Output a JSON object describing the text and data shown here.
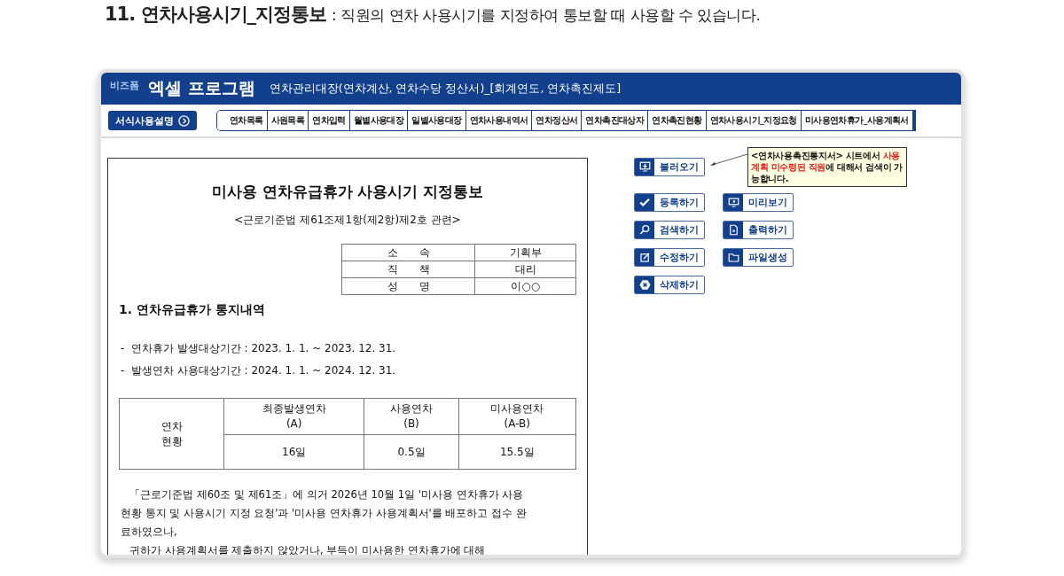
{
  "heading": {
    "title": "11. 연차사용시기_지정통보",
    "description": ": 직원의 연차 사용시기를 지정하여 통보할 때 사용할 수 있습니다."
  },
  "app_header": {
    "brand_small": "비즈폼",
    "brand": "엑셀 프로그램",
    "title": "연차관리대장(연차계산, 연차수당 정산서)_[회계연도, 연차촉진제도]"
  },
  "guide_button": {
    "label": "서식사용설명"
  },
  "tabs": [
    {
      "label": "연차목록"
    },
    {
      "label": "사원목록"
    },
    {
      "label": "연차입력"
    },
    {
      "label": "월별사용대장"
    },
    {
      "label": "일별사용대장"
    },
    {
      "label": "연차사용내역서"
    },
    {
      "label": "연차정산서"
    },
    {
      "label": "연차촉진대상자"
    },
    {
      "label": "연차촉진현황"
    },
    {
      "label": "연차사용시기_지정요청"
    },
    {
      "label": "미사용연차휴가_사용계획서"
    }
  ],
  "document": {
    "title": "미사용 연차유급휴가 사용시기 지정통보",
    "subtitle": "<근로기준법 제61조제1항(제2항)제2호 관련>",
    "info_rows": [
      {
        "label": "소　　속",
        "value": "기획부"
      },
      {
        "label": "직　　책",
        "value": "대리"
      },
      {
        "label": "성　　명",
        "value": "이○○"
      }
    ],
    "section_title": "1. 연차유급휴가 통지내역",
    "periods": [
      "-  연차휴가 발생대상기간 : 2023. 1. 1. ~ 2023. 12. 31.",
      "-  발생연차 사용대상기간 : 2024. 1. 1. ~ 2024. 12. 31."
    ],
    "status_table": {
      "row_header": "연차\n현황",
      "columns": [
        "최종발생연차\n(A)",
        "사용연차\n(B)",
        "미사용연차\n(A-B)"
      ],
      "values": [
        "16일",
        "0.5일",
        "15.5일"
      ]
    },
    "paragraphs": [
      "「근로기준법 제60조 및 제61조」에 의거 2026년 10월 1일 '미사용 연차휴가 사용현황 통지 및 사용시기 지정 요청'과 '미사용 연차휴가 사용계획서'를 배포하고 접수 완료하였으나,",
      "귀하가 사용계획서를 제출하지 않았거나, 부득이 미사용한 연차휴가에 대해"
    ]
  },
  "actions": [
    {
      "label": "불러오기"
    },
    {
      "label": "등록하기"
    },
    {
      "label": "미리보기"
    },
    {
      "label": "검색하기"
    },
    {
      "label": "출력하기"
    },
    {
      "label": "수정하기"
    },
    {
      "label": "파일생성"
    },
    {
      "label": "삭제하기"
    }
  ],
  "tooltip": {
    "segments": [
      {
        "text": "<연차사용촉진통지서> 시트에서 ",
        "highlight": false
      },
      {
        "text": "사용계획 미수령된 직원",
        "highlight": true
      },
      {
        "text": "에 대해서 검색이 가능합니다.",
        "highlight": false
      }
    ]
  }
}
